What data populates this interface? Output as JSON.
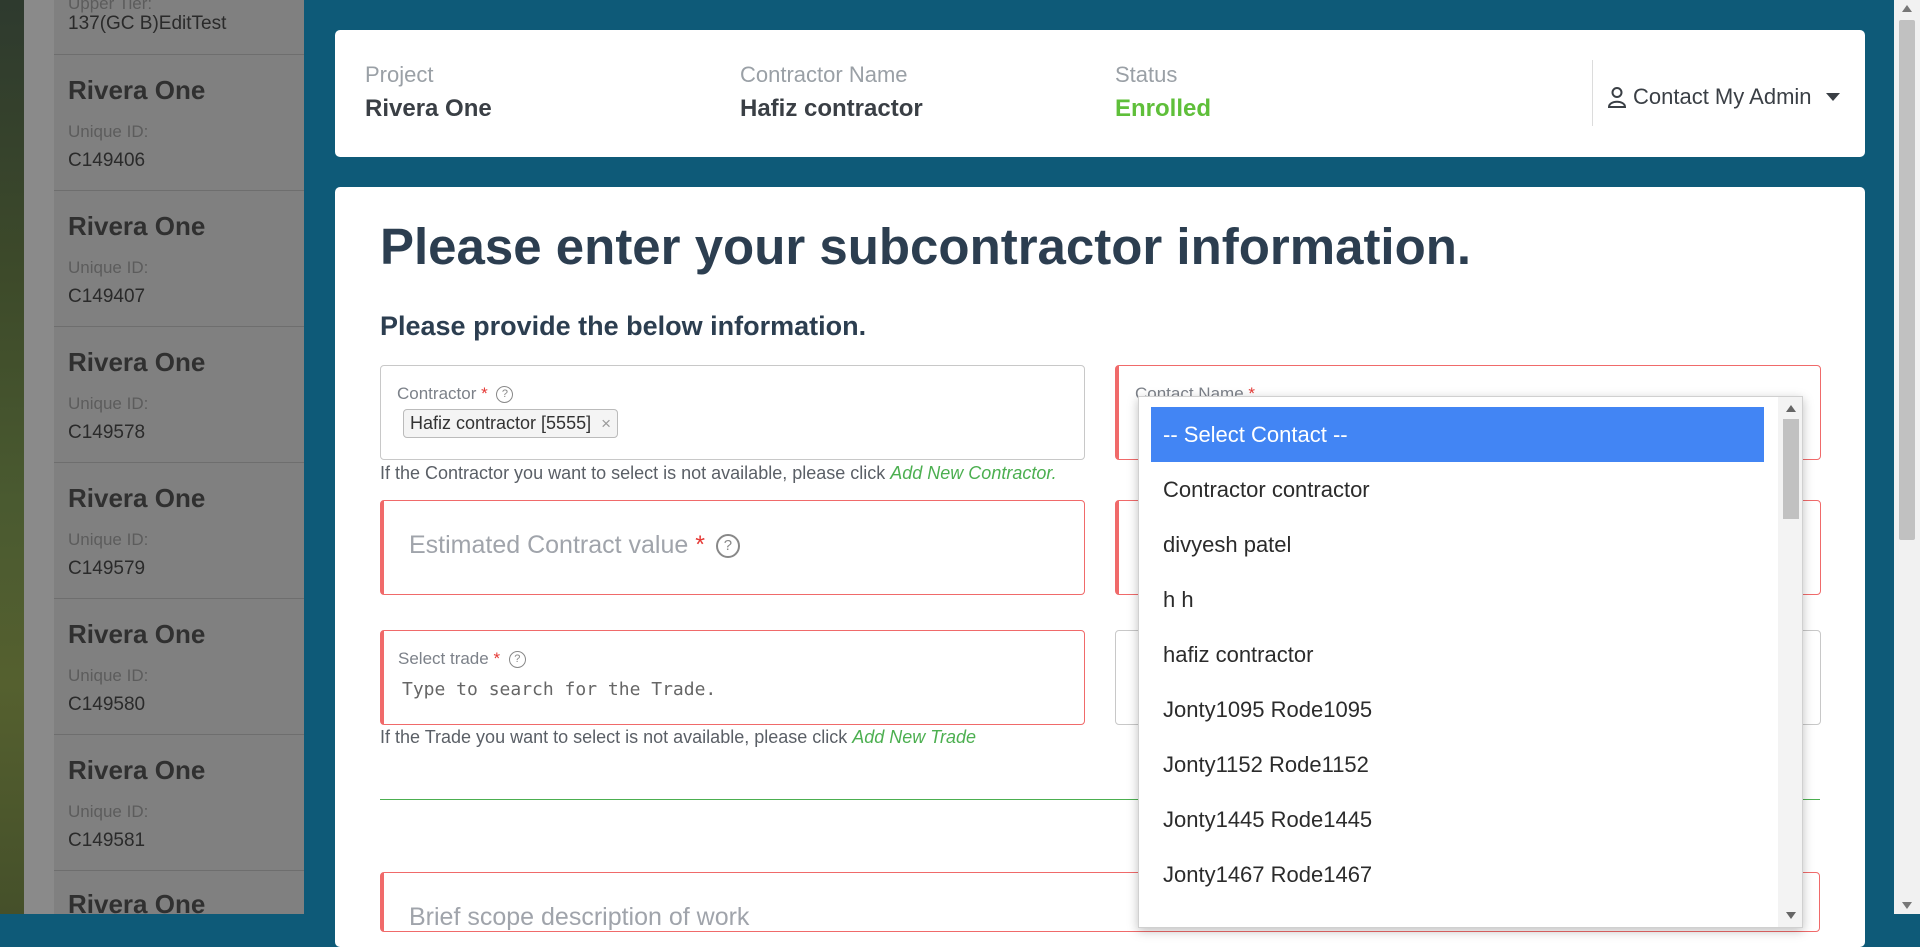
{
  "sidebar": {
    "top_sub": "Upper Tier:",
    "top_id": "137(GC B)EditTest",
    "items": [
      {
        "title": "Rivera One",
        "label": "Unique ID:",
        "id": "C149406"
      },
      {
        "title": "Rivera One",
        "label": "Unique ID:",
        "id": "C149407"
      },
      {
        "title": "Rivera One",
        "label": "Unique ID:",
        "id": "C149578"
      },
      {
        "title": "Rivera One",
        "label": "Unique ID:",
        "id": "C149579"
      },
      {
        "title": "Rivera One",
        "label": "Unique ID:",
        "id": "C149580"
      },
      {
        "title": "Rivera One",
        "label": "Unique ID:",
        "id": "C149581"
      },
      {
        "title": "Rivera One"
      }
    ]
  },
  "header": {
    "project_label": "Project",
    "project_value": "Rivera One",
    "contractor_label": "Contractor Name",
    "contractor_value": "Hafiz contractor",
    "status_label": "Status",
    "status_value": "Enrolled",
    "contact_admin": "Contact My Admin",
    "status_color": "#5fbf3a"
  },
  "form": {
    "title": "Please enter your subcontractor information.",
    "subtitle": "Please provide the below information.",
    "contractor_label": "Contractor",
    "contractor_tag": "Hafiz contractor [5555]",
    "contractor_hint": "If the Contractor you want to select is not available, please click ",
    "contractor_hint_link": "Add New Contractor.",
    "contact_name_label": "Contact Name",
    "estimated_placeholder": "Estimated Contract value",
    "trade_label": "Select trade",
    "trade_placeholder": "Type to search for the Trade.",
    "trade_hint": "If the Trade you want to select is not available, please click ",
    "trade_hint_link": "Add New Trade",
    "bottom_placeholder": "Brief scope description of work"
  },
  "dropdown": {
    "options": [
      "-- Select Contact --",
      "Contractor contractor",
      "divyesh patel",
      "h h",
      "hafiz contractor",
      "Jonty1095 Rode1095",
      "Jonty1152 Rode1152",
      "Jonty1445 Rode1445",
      "Jonty1467 Rode1467"
    ],
    "selected_color": "#4285f4"
  }
}
